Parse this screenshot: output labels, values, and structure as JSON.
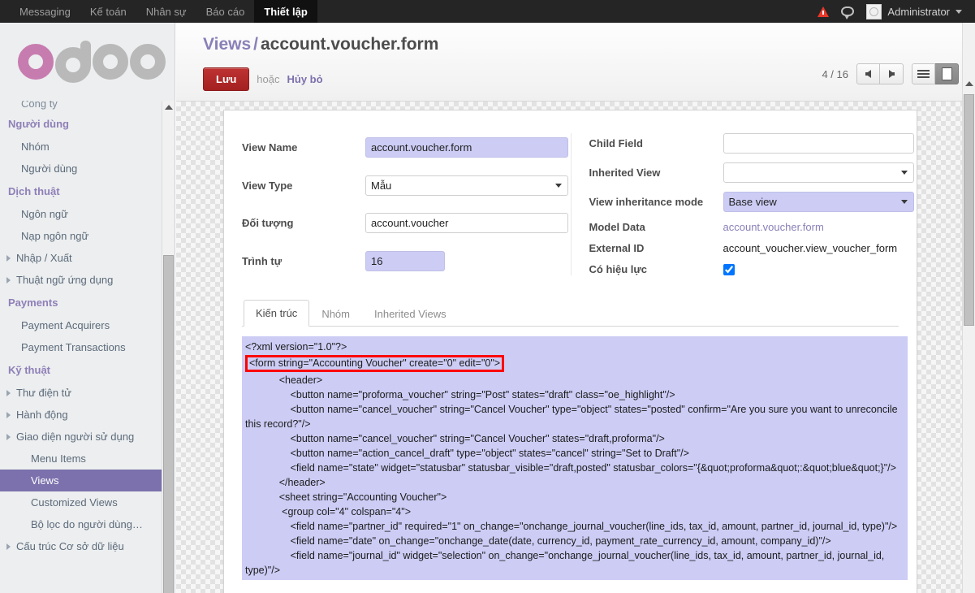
{
  "topbar": {
    "menus": [
      {
        "label": "Messaging",
        "active": false
      },
      {
        "label": "Kế toán",
        "active": false
      },
      {
        "label": "Nhân sự",
        "active": false
      },
      {
        "label": "Báo cáo",
        "active": false
      },
      {
        "label": "Thiết lập",
        "active": true
      }
    ],
    "warning_icon": "warning-triangle-icon",
    "chat_icon": "chat-bubble-icon",
    "avatar_icon": "user-avatar-icon",
    "user_name": "Administrator",
    "caret_icon": "chevron-down-icon"
  },
  "sidebar": {
    "logo_text": "odoo",
    "clipped_item": "Công ty",
    "groups": [
      {
        "title": "Người dùng",
        "items": [
          {
            "label": "Nhóm",
            "expandable": false,
            "selected": false
          },
          {
            "label": "Người dùng",
            "expandable": false,
            "selected": false
          }
        ]
      },
      {
        "title": "Dịch thuật",
        "items": [
          {
            "label": "Ngôn ngữ",
            "expandable": false,
            "selected": false
          },
          {
            "label": "Nạp ngôn ngữ",
            "expandable": false,
            "selected": false
          },
          {
            "label": "Nhập / Xuất",
            "expandable": true,
            "selected": false
          },
          {
            "label": "Thuật ngữ ứng dụng",
            "expandable": true,
            "selected": false
          }
        ]
      },
      {
        "title": "Payments",
        "items": [
          {
            "label": "Payment Acquirers",
            "expandable": false,
            "selected": false
          },
          {
            "label": "Payment Transactions",
            "expandable": false,
            "selected": false
          }
        ]
      },
      {
        "title": "Kỹ thuật",
        "items": [
          {
            "label": "Thư điện tử",
            "expandable": true,
            "selected": false
          },
          {
            "label": "Hành động",
            "expandable": true,
            "selected": false
          },
          {
            "label": "Giao diện người sử dụng",
            "expandable": true,
            "selected": false
          },
          {
            "label": "Menu Items",
            "expandable": false,
            "selected": false,
            "sub": true
          },
          {
            "label": "Views",
            "expandable": false,
            "selected": true,
            "sub": true
          },
          {
            "label": "Customized Views",
            "expandable": false,
            "selected": false,
            "sub": true
          },
          {
            "label": "Bộ lọc do người dùng…",
            "expandable": false,
            "selected": false,
            "sub": true
          },
          {
            "label": "Cấu trúc Cơ sở dữ liệu",
            "expandable": true,
            "selected": false
          }
        ]
      }
    ]
  },
  "control_panel": {
    "breadcrumb_root": "Views",
    "breadcrumb_sep": "/",
    "breadcrumb_current": "account.voucher.form",
    "save_label": "Lưu",
    "or_label": "hoặc",
    "discard_label": "Hủy bỏ",
    "pager_count": "4 / 16",
    "prev_icon": "arrow-left-icon",
    "next_icon": "arrow-right-icon",
    "list_view_icon": "list-view-icon",
    "form_view_icon": "form-view-icon"
  },
  "form": {
    "left_fields": [
      {
        "label": "View Name",
        "value": "account.voucher.form",
        "type": "text",
        "modified": true
      },
      {
        "label": "View Type",
        "value": "Mẫu",
        "type": "select",
        "modified": false
      },
      {
        "label": "Đối tượng",
        "value": "account.voucher",
        "type": "text",
        "modified": false
      },
      {
        "label": "Trình tự",
        "value": "16",
        "type": "text",
        "modified": true
      }
    ],
    "right_fields": [
      {
        "label": "Child Field",
        "value": "",
        "type": "text",
        "modified": false
      },
      {
        "label": "Inherited View",
        "value": "",
        "type": "select",
        "modified": false
      },
      {
        "label": "View inheritance mode",
        "value": "Base view",
        "type": "select",
        "modified": true
      },
      {
        "label": "Model Data",
        "value": "account.voucher.form",
        "type": "link",
        "modified": false
      },
      {
        "label": "External ID",
        "value": "account_voucher.view_voucher_form",
        "type": "readonly",
        "modified": false
      },
      {
        "label": "Có hiệu lực",
        "value": "",
        "type": "checkbox",
        "checked": true,
        "modified": false
      }
    ],
    "tabs": [
      {
        "label": "Kiến trúc",
        "active": true
      },
      {
        "label": "Nhóm",
        "active": false
      },
      {
        "label": "Inherited Views",
        "active": false
      }
    ],
    "code_lines": [
      {
        "text": "<?xml version=\"1.0\"?>",
        "highlighted": false
      },
      {
        "text": "<form string=\"Accounting Voucher\" create=\"0\" edit=\"0\">",
        "highlighted": true
      },
      {
        "text": "            <header>",
        "highlighted": false
      },
      {
        "text": "                <button name=\"proforma_voucher\" string=\"Post\" states=\"draft\" class=\"oe_highlight\"/>",
        "highlighted": false
      },
      {
        "text": "                <button name=\"cancel_voucher\" string=\"Cancel Voucher\" type=\"object\" states=\"posted\" confirm=\"Are you sure you want to unreconcile this record?\"/>",
        "highlighted": false
      },
      {
        "text": "                <button name=\"cancel_voucher\" string=\"Cancel Voucher\" states=\"draft,proforma\"/>",
        "highlighted": false
      },
      {
        "text": "                <button name=\"action_cancel_draft\" type=\"object\" states=\"cancel\" string=\"Set to Draft\"/>",
        "highlighted": false
      },
      {
        "text": "                <field name=\"state\" widget=\"statusbar\" statusbar_visible=\"draft,posted\" statusbar_colors=\"{&quot;proforma&quot;:&quot;blue&quot;}\"/>",
        "highlighted": false
      },
      {
        "text": "            </header>",
        "highlighted": false
      },
      {
        "text": "            <sheet string=\"Accounting Voucher\">",
        "highlighted": false
      },
      {
        "text": "             <group col=\"4\" colspan=\"4\">",
        "highlighted": false
      },
      {
        "text": "                <field name=\"partner_id\" required=\"1\" on_change=\"onchange_journal_voucher(line_ids, tax_id, amount, partner_id, journal_id, type)\"/>",
        "highlighted": false
      },
      {
        "text": "                <field name=\"date\" on_change=\"onchange_date(date, currency_id, payment_rate_currency_id, amount, company_id)\"/>",
        "highlighted": false
      },
      {
        "text": "                <field name=\"journal_id\" widget=\"selection\" on_change=\"onchange_journal_voucher(line_ids, tax_id, amount, partner_id, journal_id, type)\"/>",
        "highlighted": false
      }
    ]
  }
}
